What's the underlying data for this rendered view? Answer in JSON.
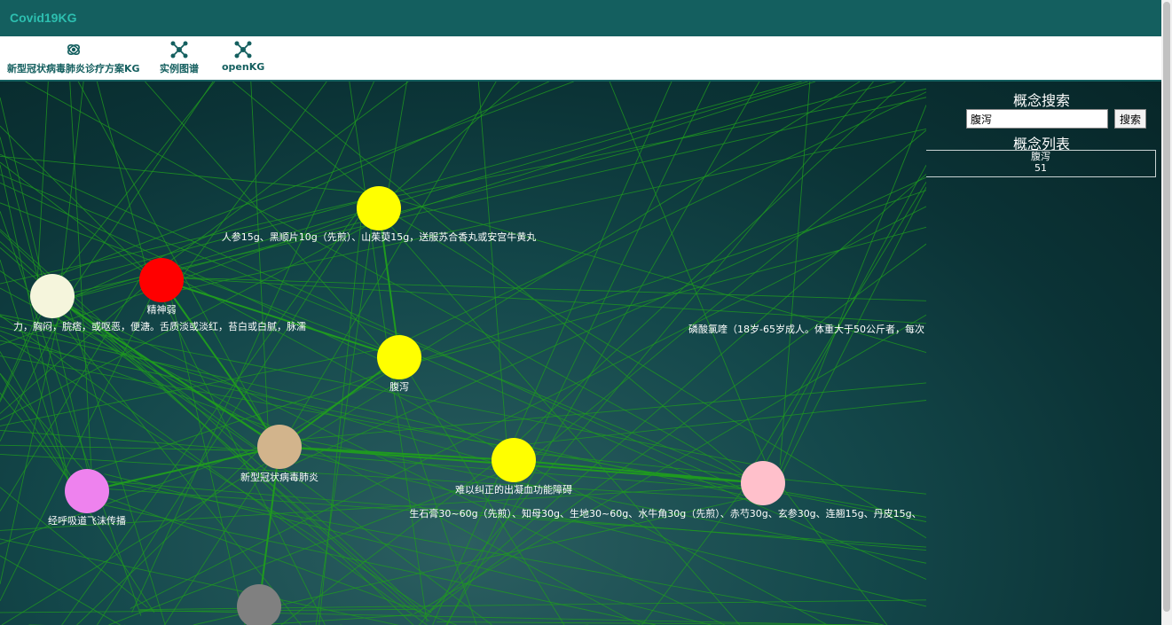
{
  "app": {
    "title": "Covid19KG"
  },
  "nav": [
    {
      "label": "新型冠状病毒肺炎诊疗方案KG",
      "icon": "atom-icon"
    },
    {
      "label": "实例图谱",
      "icon": "graph-network-icon"
    },
    {
      "label": "openKG",
      "icon": "graph-network-icon"
    }
  ],
  "search": {
    "title": "概念搜索",
    "value": "腹泻",
    "button": "搜索",
    "list_title": "概念列表",
    "result": {
      "name": "腹泻",
      "count": "51"
    }
  },
  "colors": {
    "header": "#145f5f",
    "edge": "#1f9a1f",
    "label": "#ffffff"
  },
  "graph": {
    "nodes": [
      {
        "id": "n1",
        "label": "人参15g、黑顺片10g（先煎）、山茱萸15g，送服苏合香丸或安宫牛黄丸",
        "color": "#ffff00"
      },
      {
        "id": "n2",
        "label": "精神弱",
        "color": "#ff0000"
      },
      {
        "id": "n3",
        "label": "力，胸闷，脘痞，或呕恶，便溏。舌质淡或淡红，苔白或白腻，脉濡",
        "color": "#f5f5dc"
      },
      {
        "id": "n4",
        "label": "腹泻",
        "color": "#ffff00"
      },
      {
        "id": "n5",
        "label": "新型冠状病毒肺炎",
        "color": "#d2b48c"
      },
      {
        "id": "n6",
        "label": "难以纠正的出凝血功能障碍",
        "color": "#ffff00"
      },
      {
        "id": "n7",
        "label": "经呼吸道飞沫传播",
        "color": "#ee82ee"
      },
      {
        "id": "n8",
        "label": "生石膏30~60g（先煎）、知母30g、生地30~60g、水牛角30g（先煎）、赤芍30g、玄参30g、连翘15g、丹皮15g、",
        "color": "#ffc0cb"
      },
      {
        "id": "n9",
        "label": "磷酸氯喹（18岁-65岁成人。体重大于50公斤者，每次",
        "color": "#ffffff"
      },
      {
        "id": "n10",
        "label": "",
        "color": "#808080"
      }
    ]
  }
}
